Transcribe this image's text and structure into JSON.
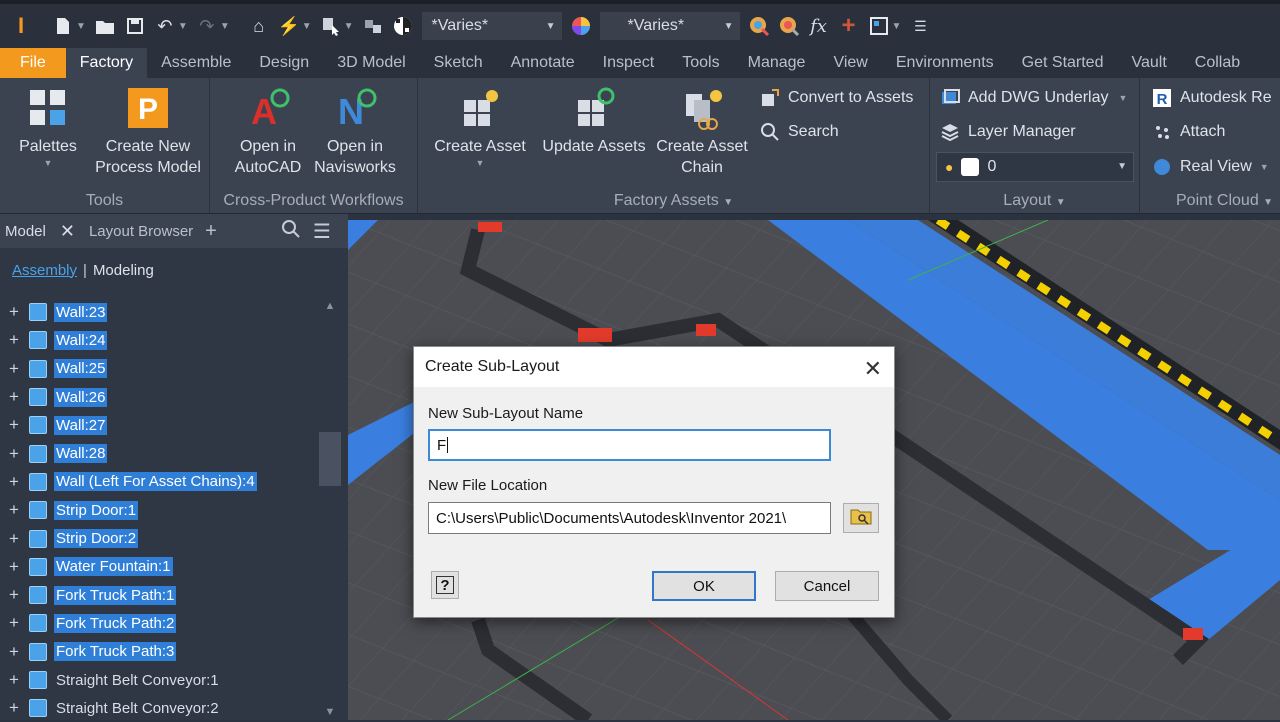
{
  "qat": {
    "select1": "*Varies*",
    "select2": "*Varies*"
  },
  "tabs": [
    "File",
    "Factory",
    "Assemble",
    "Design",
    "3D Model",
    "Sketch",
    "Annotate",
    "Inspect",
    "Tools",
    "Manage",
    "View",
    "Environments",
    "Get Started",
    "Vault",
    "Collab"
  ],
  "ribbon": {
    "tools": {
      "title": "Tools",
      "palettes": "Palettes",
      "create_new_1": "Create New",
      "create_new_2": "Process Model"
    },
    "cross": {
      "title": "Cross-Product Workflows",
      "open1a": "Open in",
      "open1b": "AutoCAD",
      "open2a": "Open in",
      "open2b": "Navisworks"
    },
    "assets": {
      "title": "Factory Assets",
      "create_asset": "Create Asset",
      "update_assets": "Update Assets",
      "chain_1": "Create Asset",
      "chain_2": "Chain",
      "convert": "Convert to Assets",
      "search": "Search"
    },
    "layout": {
      "title": "Layout",
      "add_dwg": "Add DWG Underlay",
      "layer_mgr": "Layer Manager",
      "layer_value": "0"
    },
    "point_cloud": {
      "title": "Point Cloud",
      "autodesk": "Autodesk Re",
      "attach": "Attach",
      "real_view": "Real View"
    }
  },
  "browser": {
    "tab_model": "Model",
    "tab_layout": "Layout Browser",
    "mode_assembly": "Assembly",
    "mode_modeling": "Modeling",
    "items": [
      {
        "label": "Wall:23",
        "selected": true
      },
      {
        "label": "Wall:24",
        "selected": true
      },
      {
        "label": "Wall:25",
        "selected": true
      },
      {
        "label": "Wall:26",
        "selected": true
      },
      {
        "label": "Wall:27",
        "selected": true
      },
      {
        "label": "Wall:28",
        "selected": true
      },
      {
        "label": "Wall (Left For Asset Chains):4",
        "selected": true
      },
      {
        "label": "Strip Door:1",
        "selected": true
      },
      {
        "label": "Strip Door:2",
        "selected": true
      },
      {
        "label": "Water Fountain:1",
        "selected": true
      },
      {
        "label": "Fork Truck Path:1",
        "selected": true
      },
      {
        "label": "Fork Truck Path:2",
        "selected": true
      },
      {
        "label": "Fork Truck Path:3",
        "selected": true
      },
      {
        "label": "Straight Belt Conveyor:1",
        "selected": false
      },
      {
        "label": "Straight Belt Conveyor:2",
        "selected": false
      }
    ]
  },
  "dialog": {
    "title": "Create Sub-Layout",
    "name_label": "New Sub-Layout Name",
    "name_value": "F",
    "location_label": "New File Location",
    "location_value": "C:\\Users\\Public\\Documents\\Autodesk\\Inventor 2021\\",
    "ok": "OK",
    "cancel": "Cancel"
  },
  "colors": {
    "file_tab": "#f39a1e",
    "selection": "#2f7fd8",
    "ribbon_bg": "#3b4250"
  }
}
